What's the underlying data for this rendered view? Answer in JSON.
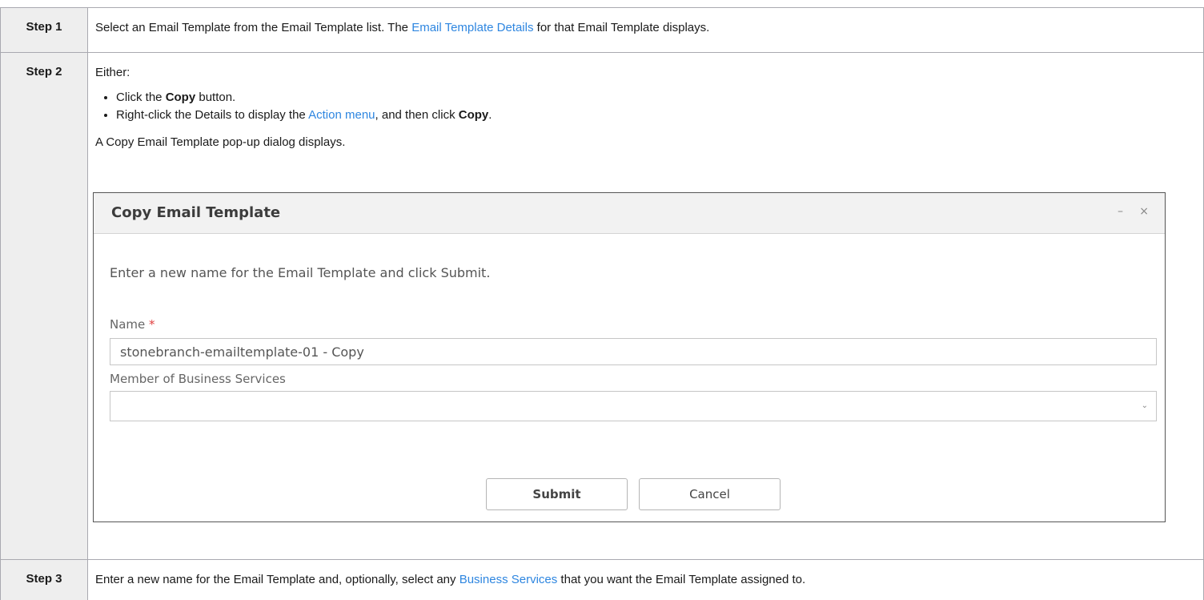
{
  "steps": [
    {
      "label": "Step 1",
      "text_before": "Select an Email Template from the Email Template list. The ",
      "link": "Email Template Details",
      "text_after": " for that Email Template displays."
    },
    {
      "label": "Step 2",
      "intro": "Either:",
      "bullets": [
        {
          "before": "Click the ",
          "bold": "Copy",
          "after": " button."
        },
        {
          "before": "Right-click the Details to display the ",
          "link": "Action menu",
          "middle": ", and then click ",
          "bold": "Copy",
          "after": "."
        }
      ],
      "after_text": "A Copy Email Template pop-up dialog displays."
    },
    {
      "label": "Step 3",
      "text_before": "Enter a new name for the Email Template and, optionally, select any ",
      "link": "Business Services",
      "text_after": " that you want the Email Template assigned to."
    }
  ],
  "dialog": {
    "title": "Copy Email Template",
    "minimize_glyph": "–",
    "close_glyph": "×",
    "instruction": "Enter a new name for the Email Template and click Submit.",
    "name_label": "Name",
    "required_mark": "*",
    "name_value": "stonebranch-emailtemplate-01 - Copy",
    "business_services_label": "Member of Business Services",
    "business_services_value": "",
    "dropdown_glyph": "⌄",
    "submit_label": "Submit",
    "cancel_label": "Cancel"
  },
  "colors": {
    "link": "#2e86e0",
    "label_cell_bg": "#eeeeee",
    "border": "#a9a9b0",
    "required": "#e04040"
  }
}
